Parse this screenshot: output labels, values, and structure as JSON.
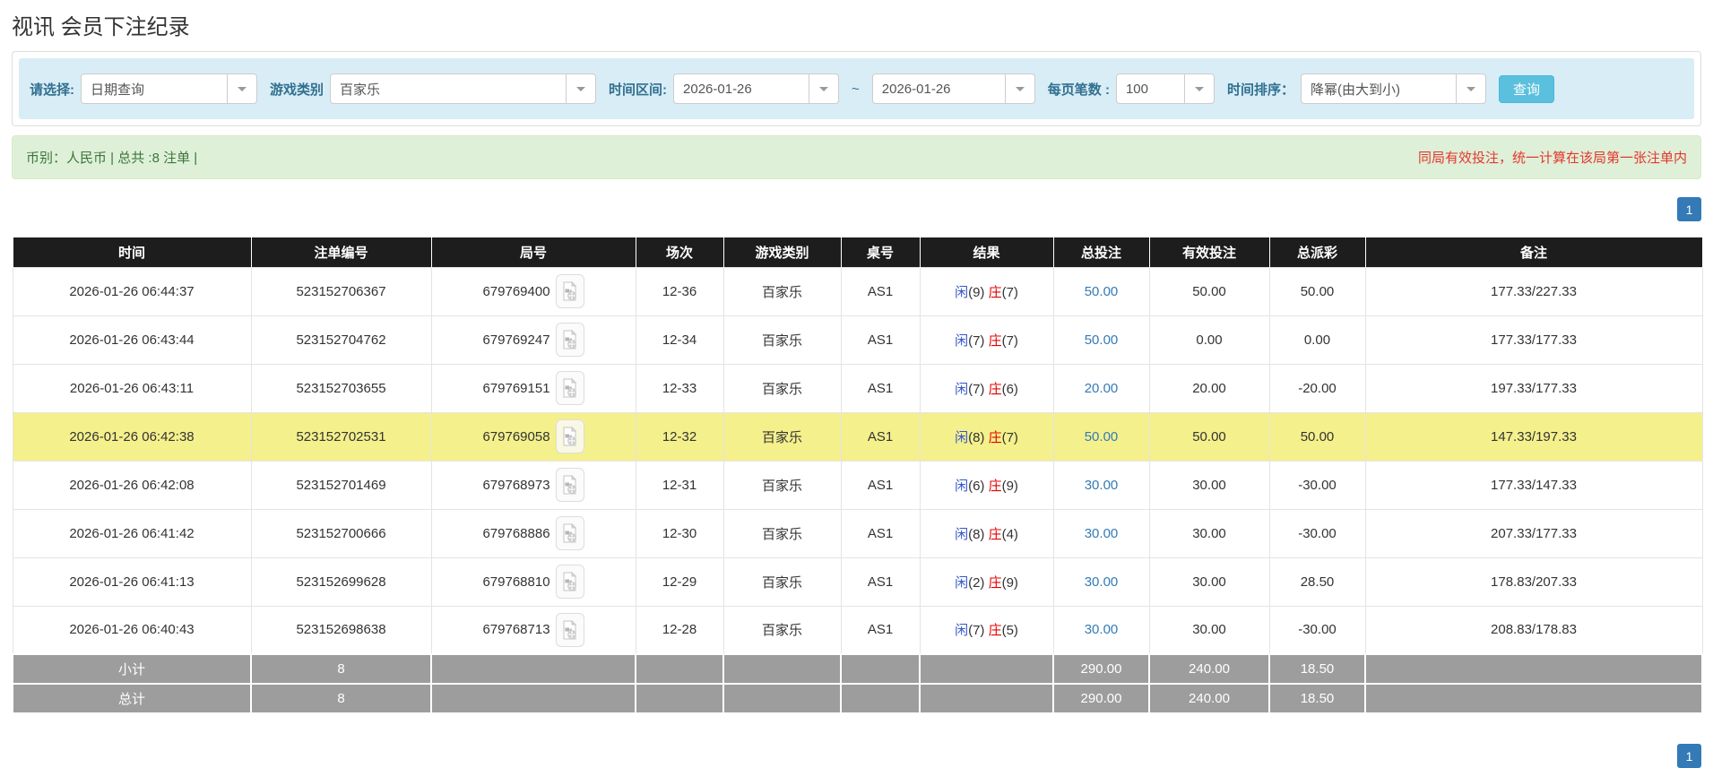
{
  "title": "视讯 会员下注纪录",
  "filters": {
    "select_label": "请选择:",
    "query_type": "日期查询",
    "game_type_label": "游戏类别",
    "game_type": "百家乐",
    "time_range_label": "时间区间:",
    "date_from": "2026-01-26",
    "range_separator": "~",
    "date_to": "2026-01-26",
    "page_size_label": "每页笔数 :",
    "page_size": "100",
    "time_sort_label": "时间排序：",
    "time_sort": "降幂(由大到小)",
    "query_button": "查询"
  },
  "info": {
    "left": "币别：人民币 | 总共 :8 注单 |",
    "right": "同局有效投注，统一计算在该局第一张注单内"
  },
  "pagination": {
    "page": "1"
  },
  "table": {
    "headers": [
      "时间",
      "注单编号",
      "局号",
      "场次",
      "游戏类别",
      "桌号",
      "结果",
      "总投注",
      "有效投注",
      "总派彩",
      "备注"
    ],
    "rows": [
      {
        "time": "2026-01-26 06:44:37",
        "bet_no": "523152706367",
        "round_no": "679769400",
        "session": "12-36",
        "game": "百家乐",
        "table_no": "AS1",
        "result": {
          "player_label": "闲",
          "player_value": "(9)",
          "banker_label": "庄",
          "banker_value": "(7)"
        },
        "total_bet": "50.00",
        "valid_bet": "50.00",
        "payout": "50.00",
        "note": "177.33/227.33",
        "highlighted": false
      },
      {
        "time": "2026-01-26 06:43:44",
        "bet_no": "523152704762",
        "round_no": "679769247",
        "session": "12-34",
        "game": "百家乐",
        "table_no": "AS1",
        "result": {
          "player_label": "闲",
          "player_value": "(7)",
          "banker_label": "庄",
          "banker_value": "(7)"
        },
        "total_bet": "50.00",
        "valid_bet": "0.00",
        "payout": "0.00",
        "note": "177.33/177.33",
        "highlighted": false
      },
      {
        "time": "2026-01-26 06:43:11",
        "bet_no": "523152703655",
        "round_no": "679769151",
        "session": "12-33",
        "game": "百家乐",
        "table_no": "AS1",
        "result": {
          "player_label": "闲",
          "player_value": "(7)",
          "banker_label": "庄",
          "banker_value": "(6)"
        },
        "total_bet": "20.00",
        "valid_bet": "20.00",
        "payout": "-20.00",
        "note": "197.33/177.33",
        "highlighted": false
      },
      {
        "time": "2026-01-26 06:42:38",
        "bet_no": "523152702531",
        "round_no": "679769058",
        "session": "12-32",
        "game": "百家乐",
        "table_no": "AS1",
        "result": {
          "player_label": "闲",
          "player_value": "(8)",
          "banker_label": "庄",
          "banker_value": "(7)"
        },
        "total_bet": "50.00",
        "valid_bet": "50.00",
        "payout": "50.00",
        "note": "147.33/197.33",
        "highlighted": true
      },
      {
        "time": "2026-01-26 06:42:08",
        "bet_no": "523152701469",
        "round_no": "679768973",
        "session": "12-31",
        "game": "百家乐",
        "table_no": "AS1",
        "result": {
          "player_label": "闲",
          "player_value": "(6)",
          "banker_label": "庄",
          "banker_value": "(9)"
        },
        "total_bet": "30.00",
        "valid_bet": "30.00",
        "payout": "-30.00",
        "note": "177.33/147.33",
        "highlighted": false
      },
      {
        "time": "2026-01-26 06:41:42",
        "bet_no": "523152700666",
        "round_no": "679768886",
        "session": "12-30",
        "game": "百家乐",
        "table_no": "AS1",
        "result": {
          "player_label": "闲",
          "player_value": "(8)",
          "banker_label": "庄",
          "banker_value": "(4)"
        },
        "total_bet": "30.00",
        "valid_bet": "30.00",
        "payout": "-30.00",
        "note": "207.33/177.33",
        "highlighted": false
      },
      {
        "time": "2026-01-26 06:41:13",
        "bet_no": "523152699628",
        "round_no": "679768810",
        "session": "12-29",
        "game": "百家乐",
        "table_no": "AS1",
        "result": {
          "player_label": "闲",
          "player_value": "(2)",
          "banker_label": "庄",
          "banker_value": "(9)"
        },
        "total_bet": "30.00",
        "valid_bet": "30.00",
        "payout": "28.50",
        "note": "178.83/207.33",
        "highlighted": false
      },
      {
        "time": "2026-01-26 06:40:43",
        "bet_no": "523152698638",
        "round_no": "679768713",
        "session": "12-28",
        "game": "百家乐",
        "table_no": "AS1",
        "result": {
          "player_label": "闲",
          "player_value": "(7)",
          "banker_label": "庄",
          "banker_value": "(5)"
        },
        "total_bet": "30.00",
        "valid_bet": "30.00",
        "payout": "-30.00",
        "note": "208.83/178.83",
        "highlighted": false
      }
    ],
    "footer": [
      {
        "label": "小计",
        "count": "8",
        "total_bet": "290.00",
        "valid_bet": "240.00",
        "payout": "18.50"
      },
      {
        "label": "总计",
        "count": "8",
        "total_bet": "290.00",
        "valid_bet": "240.00",
        "payout": "18.50"
      }
    ]
  },
  "colors": {
    "header_bg": "#1d1d1d",
    "highlight_row": "#f4f08c",
    "footer_row": "#9d9d9d",
    "link_blue": "#337ab7",
    "negative_red": "#e60000",
    "player_blue": "#3355cc",
    "banker_red": "#e60000",
    "filter_bar_bg": "#d9edf7",
    "info_bar_bg": "#dff0d8",
    "info_text_green": "#3c763d",
    "warning_text_red": "#e4362d",
    "query_button_bg": "#5bc0de",
    "pager_bg": "#337ab7"
  }
}
